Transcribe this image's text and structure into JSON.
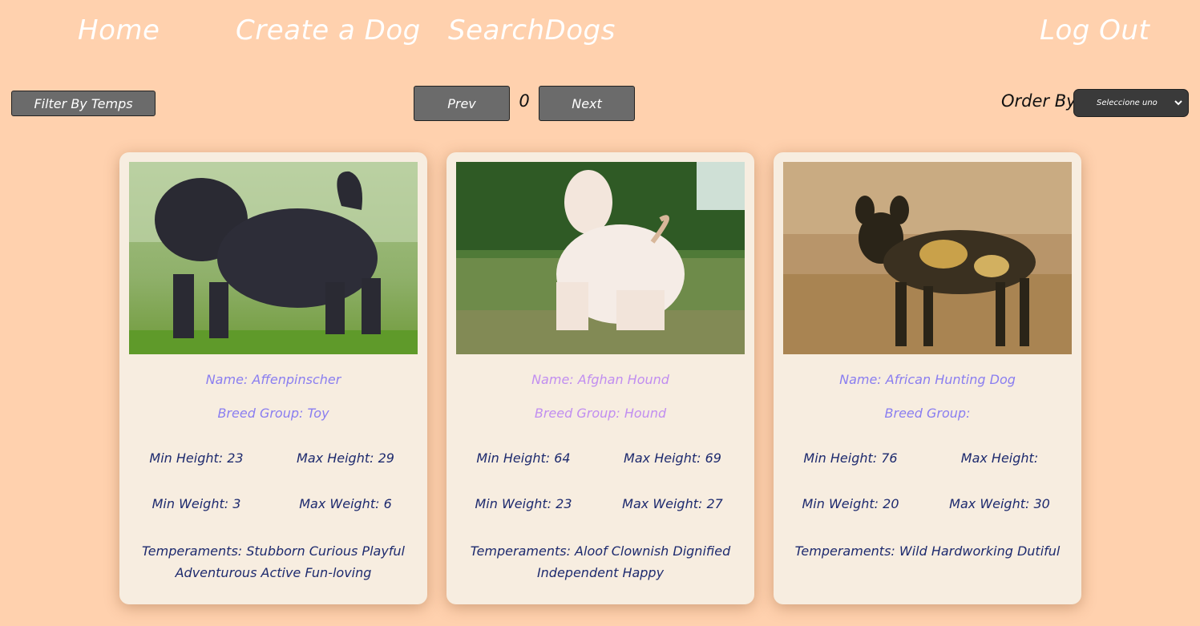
{
  "nav": {
    "home": "Home",
    "create": "Create a Dog",
    "search": "SearchDogs",
    "logout": "Log Out"
  },
  "toolbar": {
    "filter_label": "Filter By Temps",
    "prev_label": "Prev",
    "page": "0",
    "next_label": "Next",
    "order_label": "Order By",
    "order_selected": "Seleccione uno"
  },
  "colors": {
    "background": "#ffd1ae",
    "card": "#f7ede0",
    "button": "#6b6b6b",
    "name_blue": "#8a7ef0",
    "name_purple": "#c18ef0",
    "stats_text": "#1d2a6e"
  },
  "cards": [
    {
      "name": "Name: Affenpinscher",
      "breed": "Breed Group: Toy",
      "min_height": "Min Height: 23",
      "max_height": "Max Height: 29",
      "min_weight": "Min Weight: 3",
      "max_weight": "Max Weight: 6",
      "temperaments": "Temperaments: Stubborn Curious Playful Adventurous Active Fun-loving",
      "image": "dog-photo-affenpinscher"
    },
    {
      "name": "Name: Afghan Hound",
      "breed": "Breed Group: Hound",
      "min_height": "Min Height: 64",
      "max_height": "Max Height: 69",
      "min_weight": "Min Weight: 23",
      "max_weight": "Max Weight: 27",
      "temperaments": "Temperaments: Aloof Clownish Dignified Independent Happy",
      "image": "dog-photo-afghan-hound"
    },
    {
      "name": "Name: African Hunting Dog",
      "breed": "Breed Group:",
      "min_height": "Min Height: 76",
      "max_height": "Max Height:",
      "min_weight": "Min Weight: 20",
      "max_weight": "Max Weight: 30",
      "temperaments": "Temperaments: Wild Hardworking Dutiful",
      "image": "dog-photo-african-hunting-dog"
    }
  ]
}
